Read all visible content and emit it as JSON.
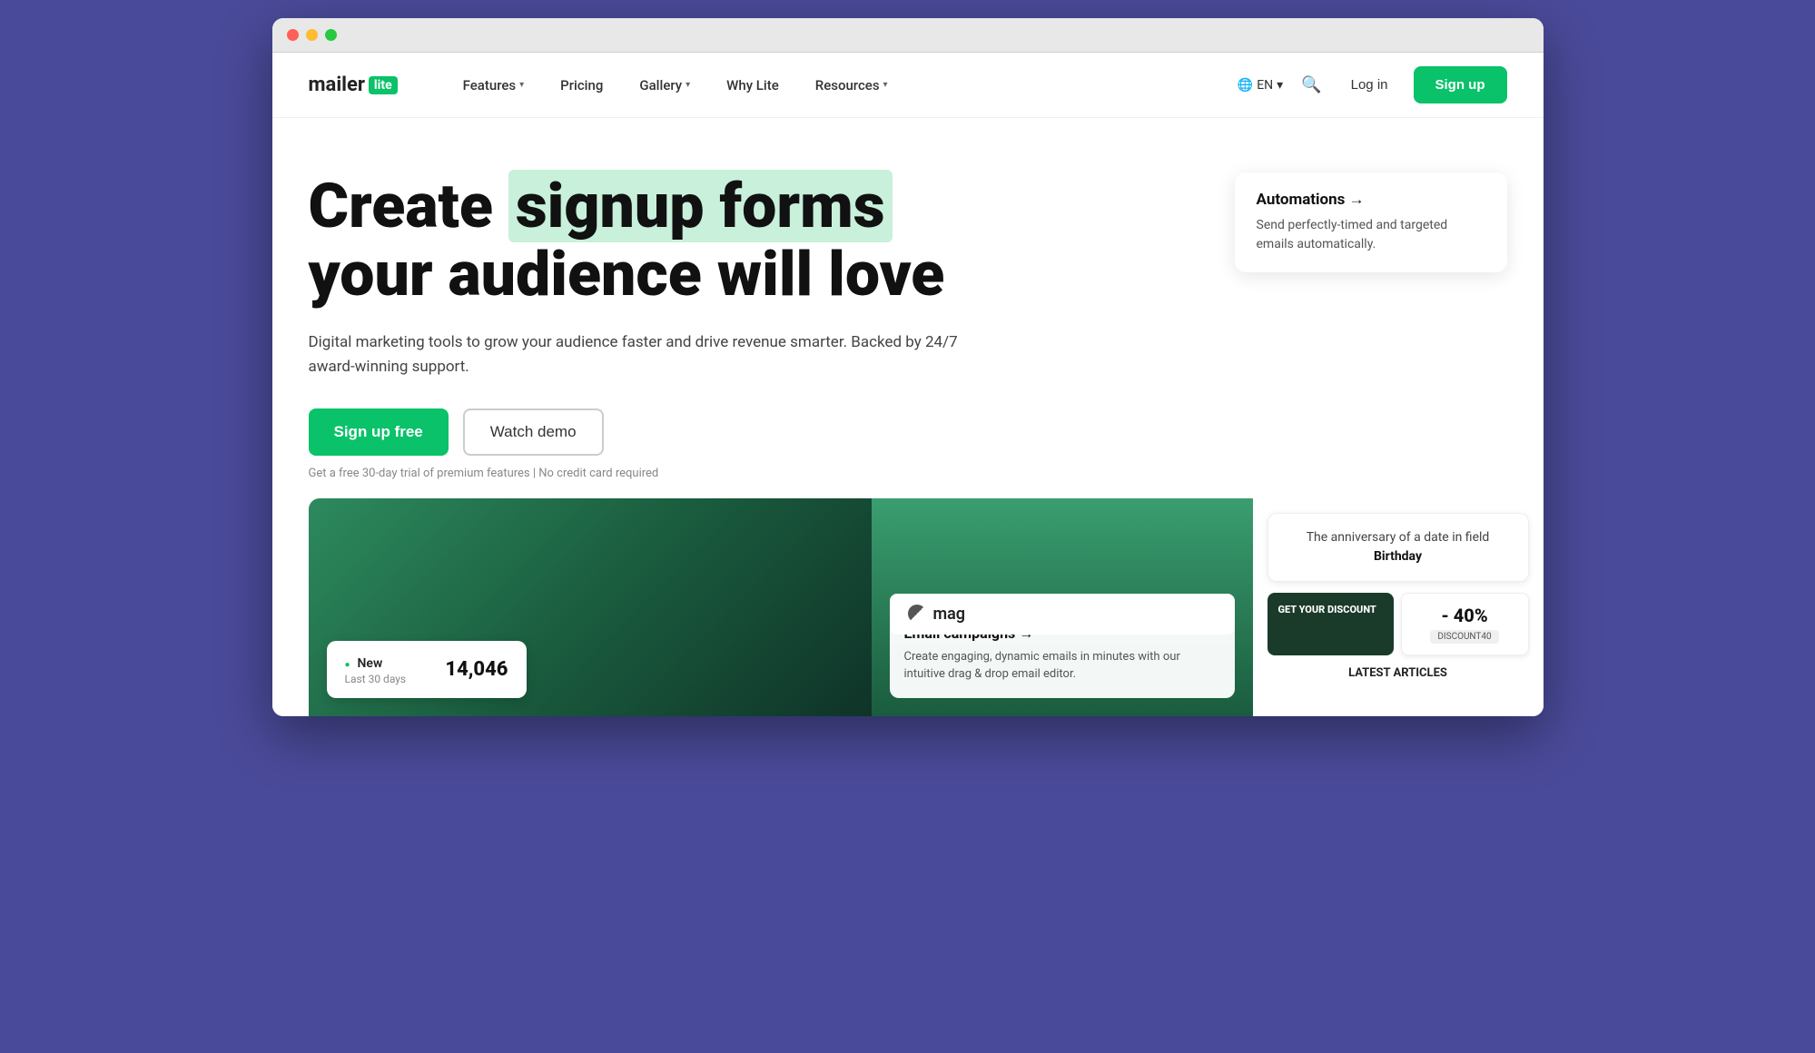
{
  "browser": {
    "traffic_lights": [
      "red",
      "yellow",
      "green"
    ]
  },
  "nav": {
    "logo": {
      "mailer": "mailer",
      "lite": "lite"
    },
    "items": [
      {
        "label": "Features",
        "has_dropdown": true
      },
      {
        "label": "Pricing",
        "has_dropdown": false
      },
      {
        "label": "Gallery",
        "has_dropdown": true
      },
      {
        "label": "Why Lite",
        "has_dropdown": false
      },
      {
        "label": "Resources",
        "has_dropdown": true
      }
    ],
    "lang": "EN",
    "login_label": "Log in",
    "signup_label": "Sign up"
  },
  "hero": {
    "headline_prefix": "Create",
    "headline_highlight": "signup forms",
    "headline_suffix": "your audience will love",
    "subheadline": "Digital marketing tools to grow your audience faster and drive revenue smarter. Backed by 24/7 award-winning support.",
    "cta_primary": "Sign up free",
    "cta_secondary": "Watch demo",
    "trial_note": "Get a free 30-day trial of premium features | No credit card required"
  },
  "feature_card": {
    "title": "Automations →",
    "description": "Send perfectly-timed and targeted emails automatically."
  },
  "showcase": {
    "stats": {
      "dot_color": "#09c269",
      "label": "New",
      "sublabel": "Last 30 days",
      "number": "14,046"
    },
    "email_campaign": {
      "title": "Email campaigns →",
      "description": "Create engaging, dynamic emails in minutes with our intuitive drag & drop email editor.",
      "mag_label": "mag"
    },
    "anniversary": {
      "text": "The anniversary of a date in field",
      "bold": "Birthday"
    },
    "discount": {
      "label": "GET YOUR DISCOUNT",
      "percent": "- 40%",
      "code": "DISCOUNT40"
    },
    "latest_articles": "LATEST ARTICLES"
  }
}
